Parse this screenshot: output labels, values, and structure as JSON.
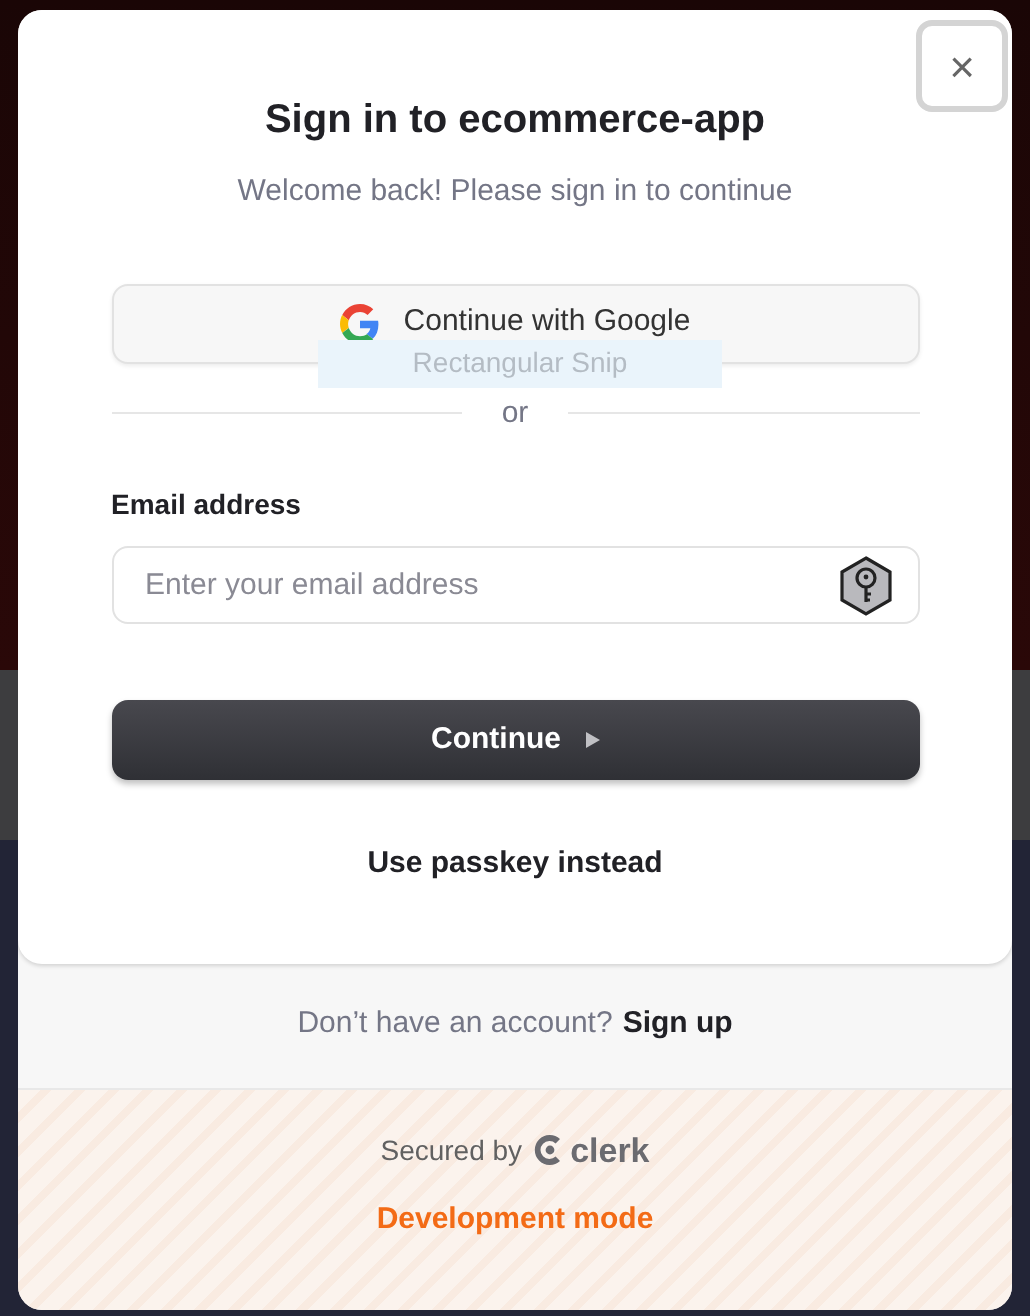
{
  "dialog": {
    "title": "Sign in to ecommerce-app",
    "subtitle": "Welcome back! Please sign in to continue",
    "close_label": "×"
  },
  "social_button": {
    "label": "Continue with Google"
  },
  "tooltip": {
    "text": "Rectangular Snip"
  },
  "divider": {
    "text": "or"
  },
  "email": {
    "label": "Email address",
    "placeholder": "Enter your email address"
  },
  "continue_button": {
    "label": "Continue"
  },
  "passkey_link": {
    "label": "Use passkey instead"
  },
  "footer": {
    "prompt": "Don’t have an account?",
    "link": "Sign up",
    "secured_by": "Secured by",
    "brand": "clerk",
    "mode": "Development mode"
  }
}
